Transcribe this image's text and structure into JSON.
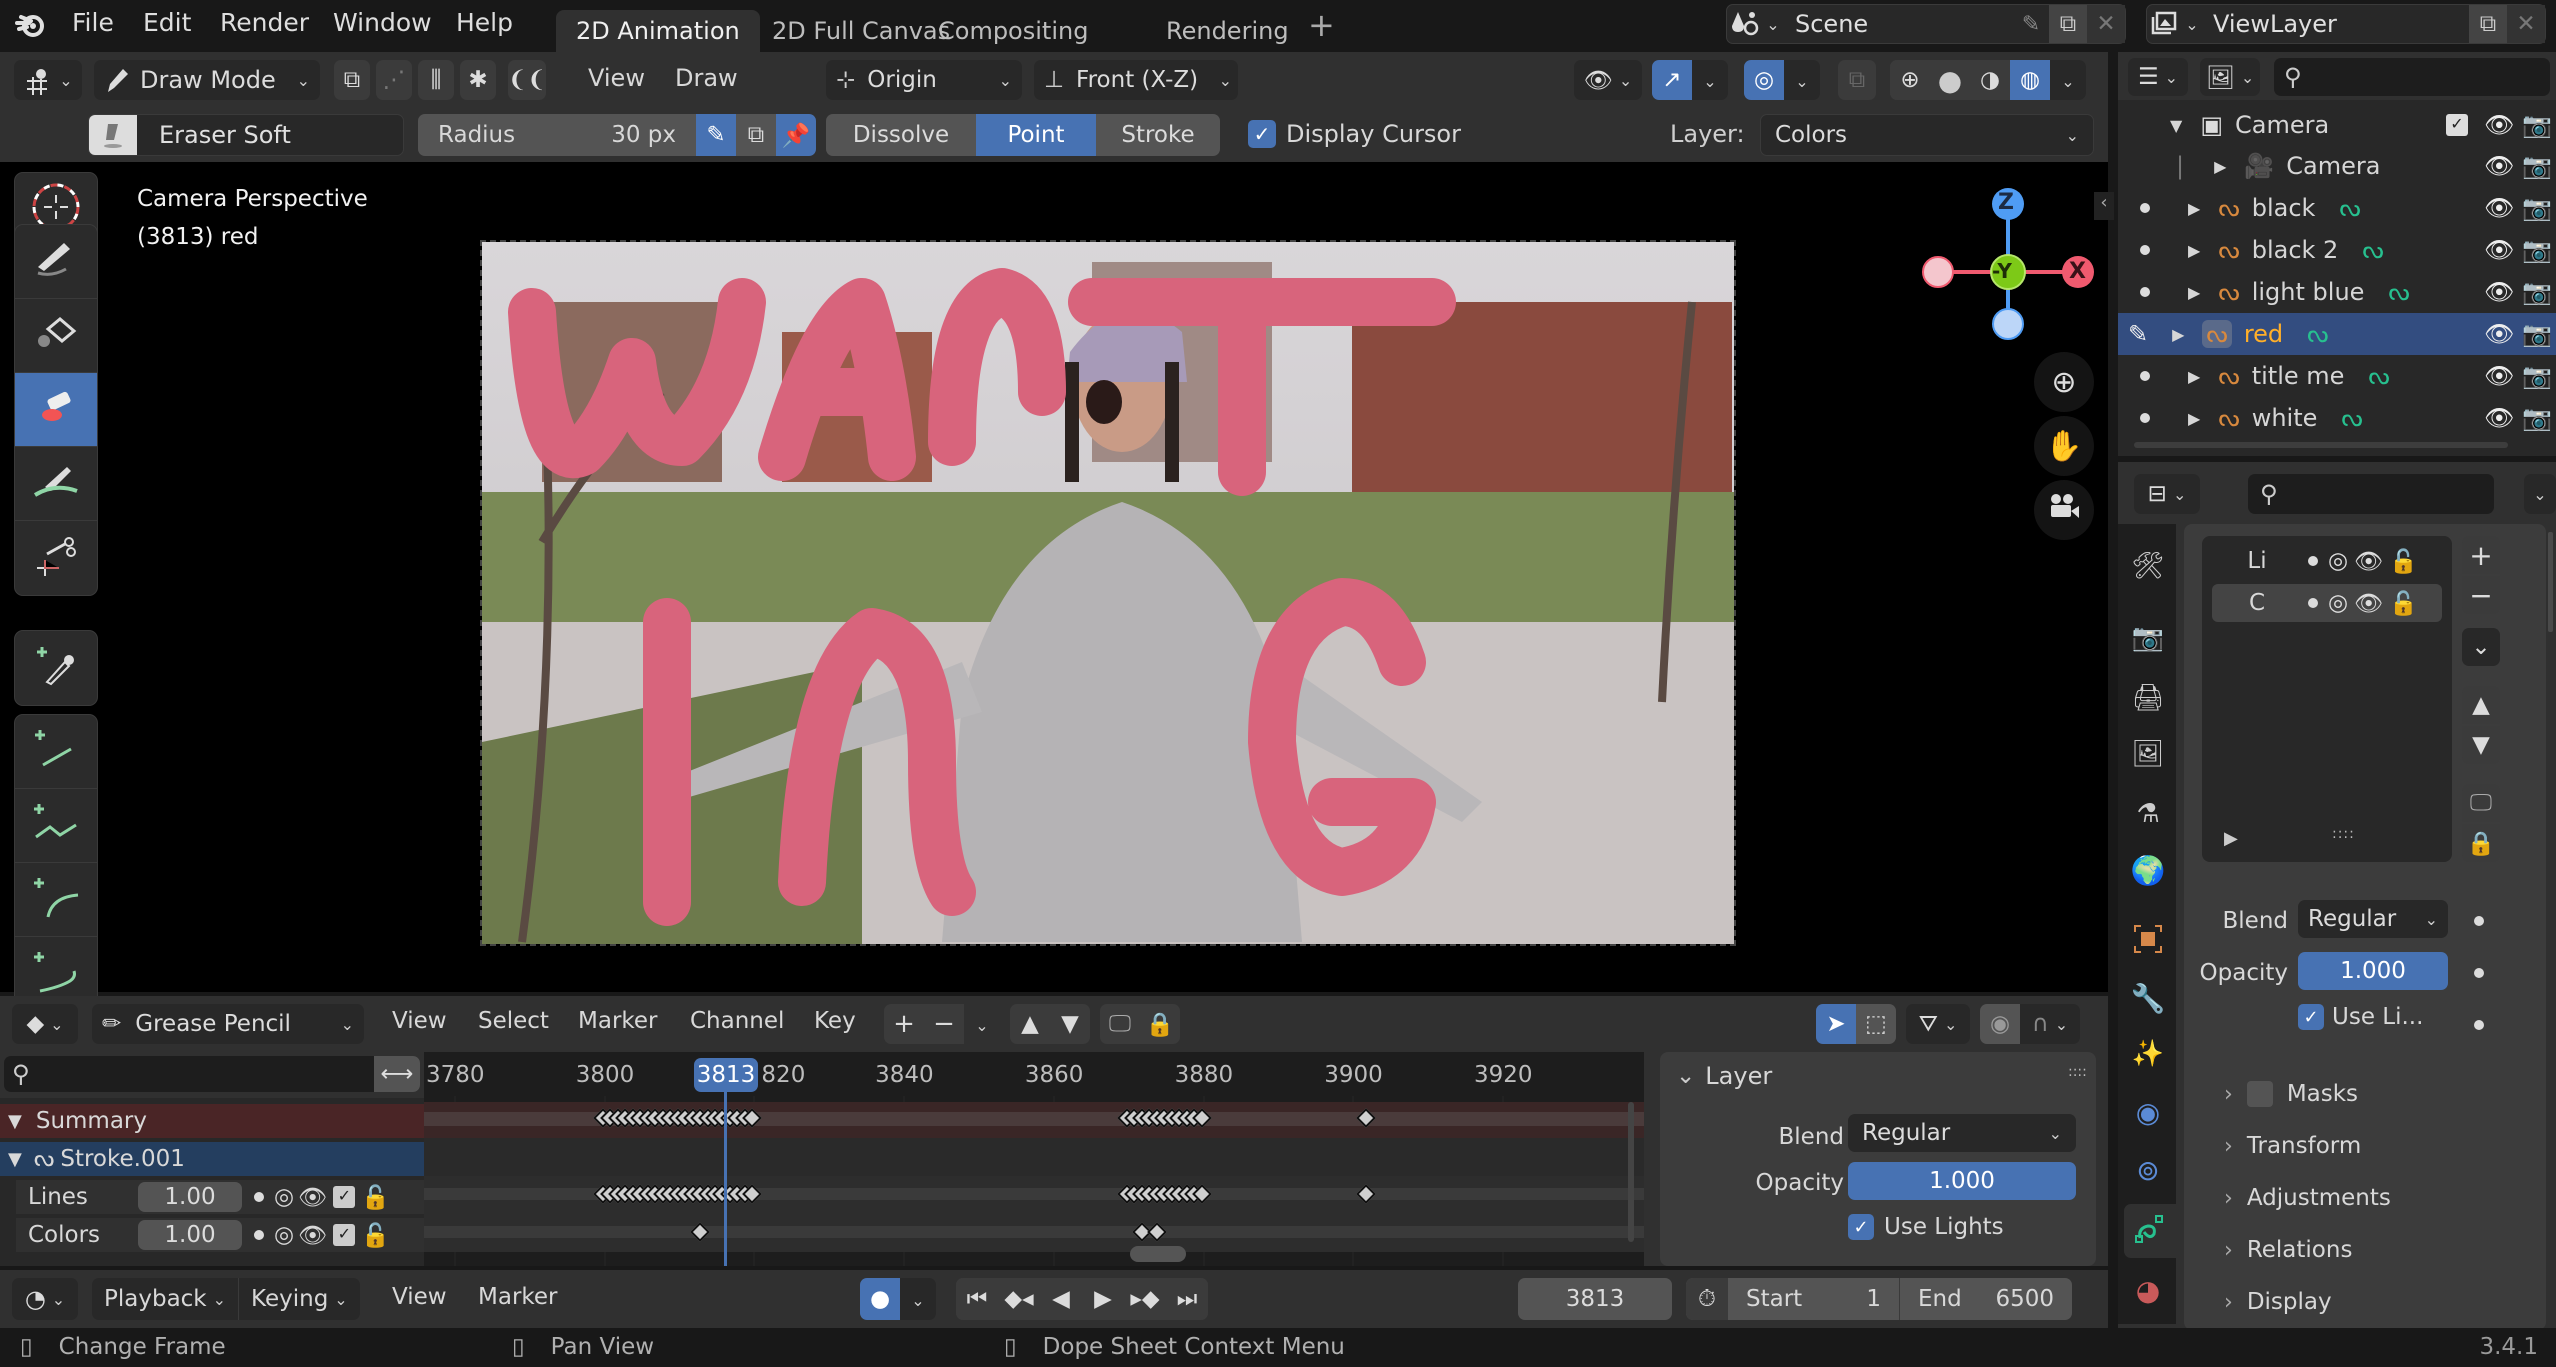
{
  "app": {
    "version": "3.4.1",
    "logo": "blender-logo-icon"
  },
  "menu": [
    "File",
    "Edit",
    "Render",
    "Window",
    "Help"
  ],
  "workspaces": [
    {
      "label": "2D Animation",
      "active": true
    },
    {
      "label": "2D Full Canvas",
      "active": false
    },
    {
      "label": "Compositing",
      "active": false
    },
    {
      "label": "Rendering",
      "active": false
    }
  ],
  "workspace_add": "+",
  "scene": {
    "label": "Scene",
    "icon": "scene-icon"
  },
  "view_layer": {
    "label": "ViewLayer",
    "icon": "render-layers-icon"
  },
  "viewport_header": {
    "mode": "Draw Mode",
    "menus": [
      "View",
      "Draw"
    ],
    "pivot": "Origin",
    "orientation": "Front (X-Z)"
  },
  "tool_settings": {
    "brush": "Eraser Soft",
    "radius_label": "Radius",
    "radius_value": "30 px",
    "modes": [
      {
        "label": "Dissolve",
        "active": false
      },
      {
        "label": "Point",
        "active": true
      },
      {
        "label": "Stroke",
        "active": false
      }
    ],
    "display_cursor": {
      "label": "Display Cursor",
      "checked": true
    },
    "layer_label": "Layer:",
    "layer_value": "Colors"
  },
  "viewport": {
    "title": "Camera Perspective",
    "subtitle": "(3813) red",
    "drawn_text_line1": "WANT",
    "drawn_text_line2": "ING",
    "stroke_color": "#d8647c",
    "gizmo": {
      "z": "Z",
      "y": "-Y",
      "x": "X"
    }
  },
  "outliner": {
    "search_placeholder": "",
    "items": [
      {
        "name": "Camera",
        "type": "collection",
        "checked": true
      },
      {
        "name": "Camera",
        "type": "camera"
      },
      {
        "name": "black",
        "type": "gpencil"
      },
      {
        "name": "black 2",
        "type": "gpencil"
      },
      {
        "name": "light blue",
        "type": "gpencil"
      },
      {
        "name": "red",
        "type": "gpencil",
        "selected": true
      },
      {
        "name": "title me",
        "type": "gpencil"
      },
      {
        "name": "white",
        "type": "gpencil"
      }
    ]
  },
  "properties": {
    "search_placeholder": "",
    "layers": [
      {
        "name": "Li",
        "selected": false
      },
      {
        "name": "C",
        "selected": true
      }
    ],
    "blend_label": "Blend",
    "blend_value": "Regular",
    "opacity_label": "Opacity",
    "opacity_value": "1.000",
    "use_lights_label": "Use Li...",
    "use_lights_checked": true,
    "sections": [
      "Masks",
      "Transform",
      "Adjustments",
      "Relations",
      "Display"
    ]
  },
  "dopesheet": {
    "mode": "Grease Pencil",
    "menus": [
      "View",
      "Select",
      "Marker",
      "Channel",
      "Key"
    ],
    "search_placeholder": "",
    "current_frame": "3813",
    "ticks": [
      "3780",
      "3800",
      "820",
      "3840",
      "3860",
      "3880",
      "3900",
      "3920"
    ],
    "channels": [
      {
        "name": "Summary",
        "type": "summary"
      },
      {
        "name": "Stroke.001",
        "type": "object"
      },
      {
        "name": "Lines",
        "value": "1.00"
      },
      {
        "name": "Colors",
        "value": "1.00"
      }
    ],
    "layer_panel": {
      "title": "Layer",
      "blend_label": "Blend",
      "blend_value": "Regular",
      "opacity_label": "Opacity",
      "opacity_value": "1.000",
      "use_lights_label": "Use Lights",
      "use_lights_checked": true
    }
  },
  "timeline": {
    "playback": "Playback",
    "keying": "Keying",
    "menus": [
      "View",
      "Marker"
    ],
    "current_frame": "3813",
    "start_label": "Start",
    "start_value": "1",
    "end_label": "End",
    "end_value": "6500"
  },
  "status": {
    "items": [
      "Change Frame",
      "Pan View",
      "Dope Sheet Context Menu"
    ]
  }
}
